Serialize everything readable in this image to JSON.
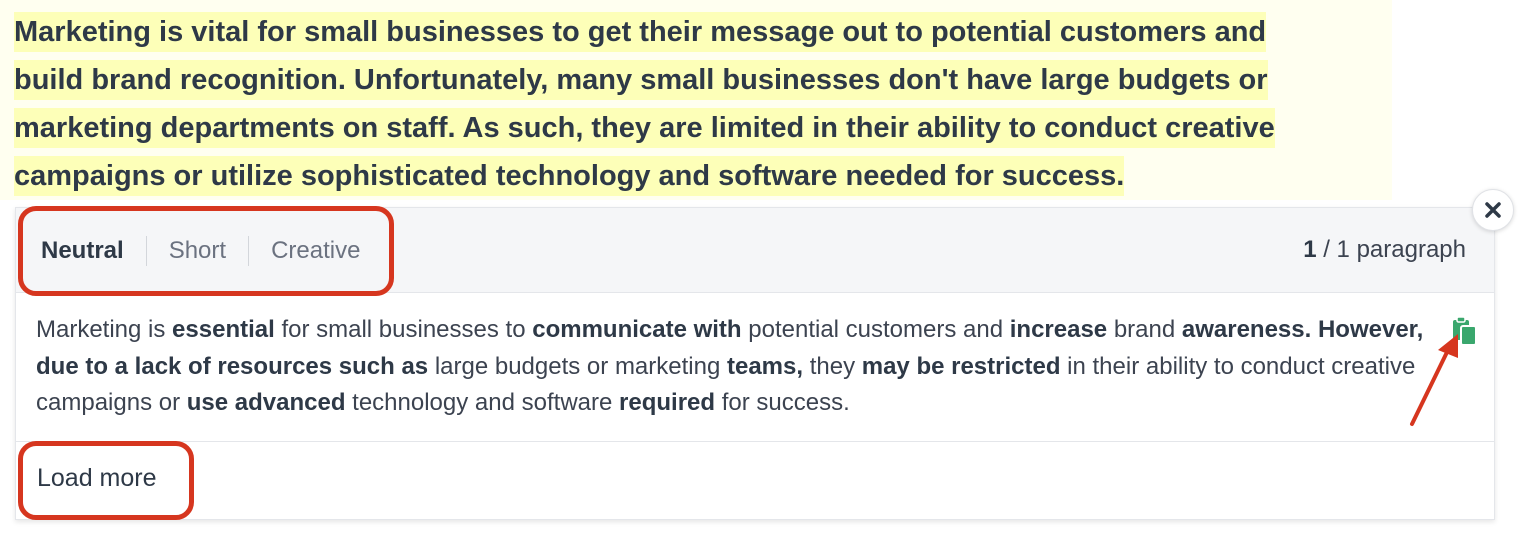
{
  "source": {
    "lines": [
      "Marketing is vital for small businesses to get their message out to potential customers and",
      "build brand recognition. Unfortunately, many small businesses don't have large budgets or",
      "marketing departments on staff. As such, they are limited in their ability to conduct creative",
      "campaigns or utilize sophisticated technology and software needed for success."
    ],
    "highlight_color": "#fdffb8"
  },
  "paraphraser": {
    "modes": [
      "Neutral",
      "Short",
      "Creative"
    ],
    "active_mode": "Neutral",
    "counter": {
      "current": "1",
      "rest": "/ 1 paragraph"
    },
    "result_segments": [
      {
        "t": "Marketing is ",
        "b": false
      },
      {
        "t": "essential",
        "b": true
      },
      {
        "t": " for small businesses to ",
        "b": false
      },
      {
        "t": "communicate with",
        "b": true
      },
      {
        "t": " potential customers and ",
        "b": false
      },
      {
        "t": "increase",
        "b": true
      },
      {
        "t": " brand ",
        "b": false
      },
      {
        "t": "awareness. However, due to a lack of resources such as",
        "b": true
      },
      {
        "t": " large budgets or marketing ",
        "b": false
      },
      {
        "t": "teams,",
        "b": true
      },
      {
        "t": " they ",
        "b": false
      },
      {
        "t": "may be restricted",
        "b": true
      },
      {
        "t": " in their ability to conduct creative campaigns or ",
        "b": false
      },
      {
        "t": "use advanced",
        "b": true
      },
      {
        "t": " technology and software ",
        "b": false
      },
      {
        "t": "required",
        "b": true
      },
      {
        "t": " for success.",
        "b": false
      }
    ],
    "copy_icon": "copy-clipboard-icon",
    "copy_icon_color": "#3aa76d",
    "load_more_label": "Load more",
    "close_icon": "close-icon"
  },
  "annotations": {
    "color": "#d6361f"
  }
}
